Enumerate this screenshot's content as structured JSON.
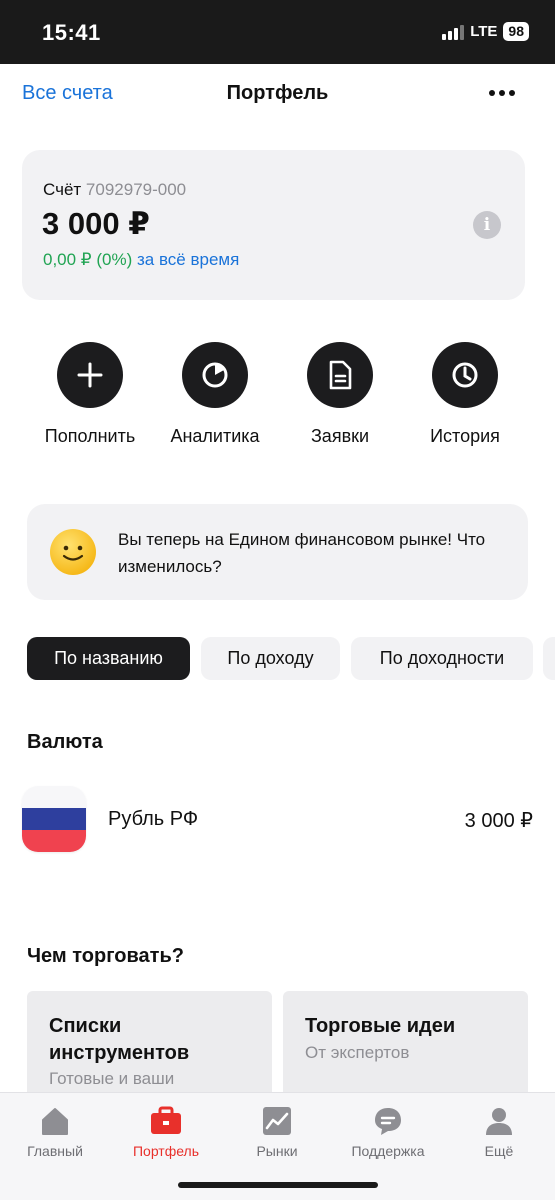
{
  "status_bar": {
    "time": "15:41",
    "network": "LTE",
    "battery": "98"
  },
  "header": {
    "back_label": "Все счета",
    "title": "Портфель",
    "more_icon": "more-dots-icon"
  },
  "account": {
    "label": "Счёт",
    "number": "7092979-000",
    "balance": "3 000 ₽",
    "change": "0,00 ₽ (0%)",
    "period": "за всё время",
    "info_icon": "info-icon"
  },
  "actions": [
    {
      "label": "Пополнить",
      "icon": "plus-icon"
    },
    {
      "label": "Аналитика",
      "icon": "pie-chart-icon"
    },
    {
      "label": "Заявки",
      "icon": "document-icon"
    },
    {
      "label": "История",
      "icon": "clock-icon"
    }
  ],
  "banner": {
    "text": "Вы теперь на Едином финансовом рынке! Что изменилось?",
    "icon": "smile-icon"
  },
  "sort_chips": [
    {
      "label": "По названию",
      "active": true
    },
    {
      "label": "По доходу",
      "active": false
    },
    {
      "label": "По доходности",
      "active": false
    }
  ],
  "currency_section": {
    "title": "Валюта",
    "items": [
      {
        "name": "Рубль РФ",
        "amount": "3 000 ₽",
        "icon": "russia-flag-icon"
      }
    ]
  },
  "trade_section": {
    "title": "Чем торговать?",
    "cards": [
      {
        "title": "Списки инструментов",
        "subtitle": "Готовые и ваши"
      },
      {
        "title": "Торговые идеи",
        "subtitle": "От экспертов"
      }
    ]
  },
  "tab_bar": [
    {
      "label": "Главный",
      "icon": "home-icon",
      "active": false
    },
    {
      "label": "Портфель",
      "icon": "briefcase-icon",
      "active": true
    },
    {
      "label": "Рынки",
      "icon": "chart-line-icon",
      "active": false
    },
    {
      "label": "Поддержка",
      "icon": "chat-icon",
      "active": false
    },
    {
      "label": "Ещё",
      "icon": "person-icon",
      "active": false
    }
  ],
  "colors": {
    "accent_blue": "#1a73d9",
    "positive_green": "#21a453",
    "active_tab_red": "#e8302b",
    "dark": "#1c1c1e"
  }
}
